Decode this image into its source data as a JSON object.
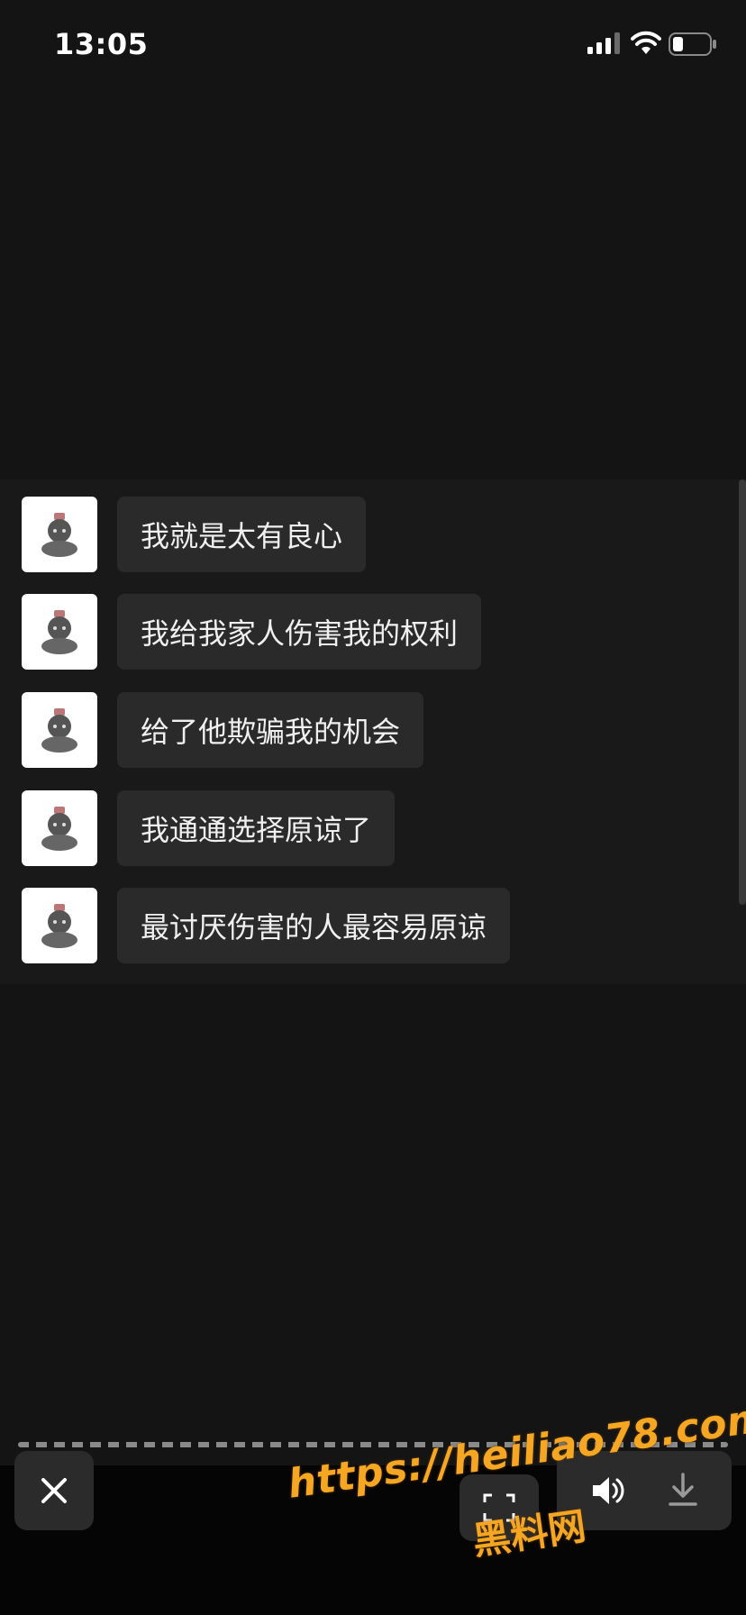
{
  "status_bar": {
    "time": "13:05",
    "icons": [
      "signal-icon",
      "wifi-icon",
      "battery-icon"
    ]
  },
  "messages": [
    {
      "text": "我就是太有良心",
      "avatar": "avatar"
    },
    {
      "text": "我给我家人伤害我的权利",
      "avatar": "avatar"
    },
    {
      "text": "给了他欺骗我的机会",
      "avatar": "avatar"
    },
    {
      "text": "我通通选择原谅了",
      "avatar": "avatar"
    },
    {
      "text": "最讨厌伤害的人最容易原谅",
      "avatar": "avatar"
    }
  ],
  "controls": {
    "icons": [
      "close-icon",
      "scan-icon",
      "speaker-icon",
      "download-icon"
    ]
  },
  "watermark": {
    "url": "https://heiliao78.com",
    "name": "黑料网"
  },
  "colors": {
    "background": "#141414",
    "bubble": "#2a2a2a",
    "watermark": "#f5a623"
  }
}
